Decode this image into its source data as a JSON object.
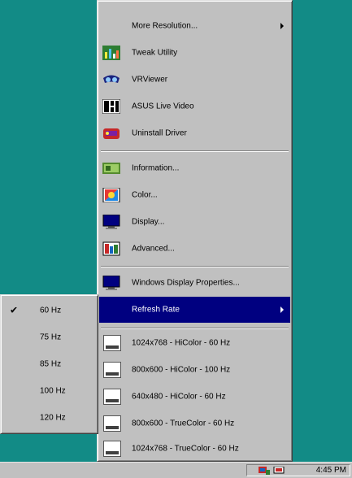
{
  "main_menu": {
    "items": [
      {
        "label": "More Resolution...",
        "has_submenu": true
      },
      {
        "label": "Tweak Utility",
        "icon": "tweak-utility-icon"
      },
      {
        "label": "VRViewer",
        "icon": "vr-viewer-icon"
      },
      {
        "label": "ASUS Live Video",
        "icon": "live-video-icon"
      },
      {
        "label": "Uninstall Driver",
        "icon": "uninstall-icon"
      },
      {
        "label": "Information...",
        "icon": "information-icon"
      },
      {
        "label": "Color...",
        "icon": "color-icon"
      },
      {
        "label": "Display...",
        "icon": "display-icon"
      },
      {
        "label": "Advanced...",
        "icon": "advanced-icon"
      },
      {
        "label": "Windows Display Properties...",
        "icon": "display-properties-icon"
      },
      {
        "label": "Refresh Rate",
        "has_submenu": true,
        "selected": true
      },
      {
        "label": "1024x768 - HiColor - 60 Hz",
        "icon": "resolution-icon"
      },
      {
        "label": "800x600 - HiColor - 100 Hz",
        "icon": "resolution-icon"
      },
      {
        "label": "640x480 - HiColor - 60 Hz",
        "icon": "resolution-icon"
      },
      {
        "label": "800x600 - TrueColor - 60 Hz",
        "icon": "resolution-icon"
      },
      {
        "label": "1024x768 - TrueColor - 60 Hz",
        "icon": "resolution-icon"
      }
    ]
  },
  "refresh_submenu": {
    "items": [
      {
        "label": "60 Hz",
        "checked": true
      },
      {
        "label": "75 Hz"
      },
      {
        "label": "85 Hz"
      },
      {
        "label": "100 Hz"
      },
      {
        "label": "120 Hz"
      }
    ],
    "check_glyph": "✔"
  },
  "taskbar": {
    "clock": "4:45 PM"
  },
  "colors": {
    "desktop": "#128b86",
    "menu": "#c0c0c0",
    "highlight": "#000080"
  }
}
